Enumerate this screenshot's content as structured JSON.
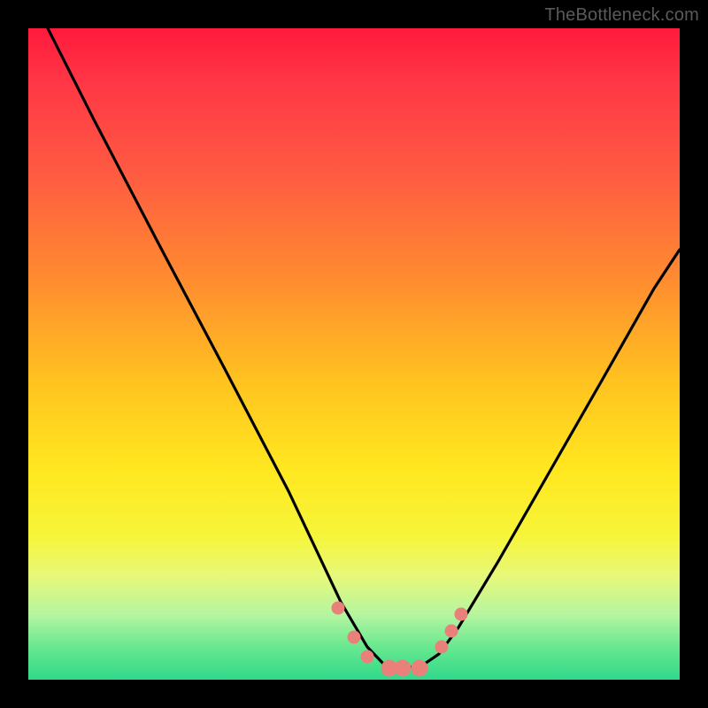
{
  "watermark": {
    "text": "TheBottleneck.com"
  },
  "chart_data": {
    "type": "line",
    "title": "",
    "xlabel": "",
    "ylabel": "",
    "xlim": [
      0,
      1
    ],
    "ylim": [
      0,
      1
    ],
    "grid": false,
    "legend": false,
    "series": [
      {
        "name": "bottleneck-curve",
        "x": [
          0.03,
          0.1,
          0.2,
          0.3,
          0.4,
          0.48,
          0.52,
          0.55,
          0.6,
          0.63,
          0.66,
          0.72,
          0.8,
          0.88,
          0.96,
          1.0
        ],
        "y": [
          1.0,
          0.86,
          0.67,
          0.48,
          0.29,
          0.12,
          0.05,
          0.02,
          0.02,
          0.04,
          0.08,
          0.18,
          0.32,
          0.46,
          0.6,
          0.66
        ]
      }
    ],
    "markers": [
      {
        "name": "left-dot-1",
        "x": 0.475,
        "y": 0.11,
        "r": 7
      },
      {
        "name": "left-dot-2",
        "x": 0.5,
        "y": 0.065,
        "r": 7
      },
      {
        "name": "left-dot-3",
        "x": 0.52,
        "y": 0.035,
        "r": 7
      },
      {
        "name": "floor-cap-1",
        "x": 0.555,
        "y": 0.018,
        "r": 9
      },
      {
        "name": "floor-cap-2",
        "x": 0.575,
        "y": 0.018,
        "r": 9
      },
      {
        "name": "floor-cap-3",
        "x": 0.6,
        "y": 0.018,
        "r": 9
      },
      {
        "name": "right-dot-1",
        "x": 0.635,
        "y": 0.05,
        "r": 7
      },
      {
        "name": "right-dot-2",
        "x": 0.65,
        "y": 0.075,
        "r": 7
      },
      {
        "name": "right-dot-3",
        "x": 0.665,
        "y": 0.1,
        "r": 7
      }
    ],
    "gradient_stops": [
      {
        "pos": 0.0,
        "color": "#ff1a3c"
      },
      {
        "pos": 0.5,
        "color": "#ffd020"
      },
      {
        "pos": 1.0,
        "color": "#2fd98a"
      }
    ]
  }
}
